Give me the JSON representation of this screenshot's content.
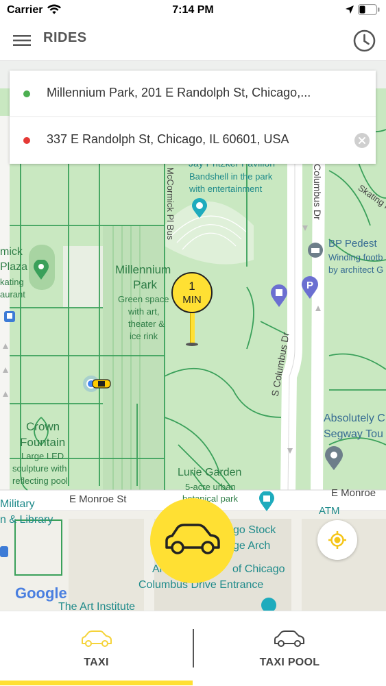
{
  "status_bar": {
    "carrier": "Carrier",
    "time": "7:14 PM"
  },
  "header": {
    "title": "RIDES"
  },
  "route": {
    "pickup": {
      "address": "Millennium Park, 201 E Randolph St, Chicago,...",
      "dot_color": "#4caf50"
    },
    "dropoff": {
      "address": "337 E Randolph St, Chicago, IL 60601, USA",
      "dot_color": "#e53935"
    }
  },
  "eta_pin": {
    "value": "1",
    "unit": "MIN"
  },
  "map_labels": {
    "pavilion": "Jay Pritzker Pavilion",
    "bandshell_1": "Bandshell in the park",
    "bandshell_2": "with entertainment",
    "mccormick": "McCormick Pl Bus",
    "columbus_dr": "Columbus Dr",
    "s_columbus_dr": "S Columbus Dr",
    "skating": "Skating Rib",
    "bp_1": "BP Pedest",
    "bp_2": "Winding footb",
    "bp_3": "by architect G",
    "mccormick_plaza_1": "mick",
    "mccormick_plaza_2": "Plaza",
    "mccormick_plaza_3": "kating",
    "mccormick_plaza_4": "aurant",
    "millennium_park_1": "Millennium",
    "millennium_park_2": "Park",
    "millennium_desc_1": "Green space",
    "millennium_desc_2": "with art,",
    "millennium_desc_3": "theater &",
    "millennium_desc_4": "ice rink",
    "crown_1": "Crown",
    "crown_2": "Fountain",
    "crown_3": "Large LED",
    "crown_4": "sculpture with",
    "crown_5": "reflecting pool",
    "absolutely_1": "Absolutely C",
    "absolutely_2": "Segway Tou",
    "lurie_1": "Lurie Garden",
    "lurie_2": "5-acre urban",
    "lurie_3": "botanical park",
    "monroe_left": "E Monroe St",
    "monroe_right": "E Monroe",
    "military_1": "Military",
    "military_2": "n & Library",
    "atm": "ATM",
    "stock_1": "go Stock",
    "stock_2": "ge Arch",
    "art_inst_1": "Art Institute of Chicago",
    "art_inst_1_prefix": "Ar",
    "art_inst_1_suffix": "of Chicago",
    "art_inst_2": "Columbus Drive Entrance",
    "art_inst_3": "The Art Institute",
    "google": "Google"
  },
  "tabs": [
    {
      "label": "TAXI",
      "icon": "car-outline-icon",
      "active": true,
      "icon_color": "#f5d33a"
    },
    {
      "label": "TAXI POOL",
      "icon": "car-outline-icon",
      "active": false,
      "icon_color": "#444444"
    }
  ],
  "colors": {
    "accent_yellow": "#ffe033",
    "park_green": "#c9e8c1",
    "path_green": "#3aa05a",
    "road_white": "#ffffff"
  }
}
